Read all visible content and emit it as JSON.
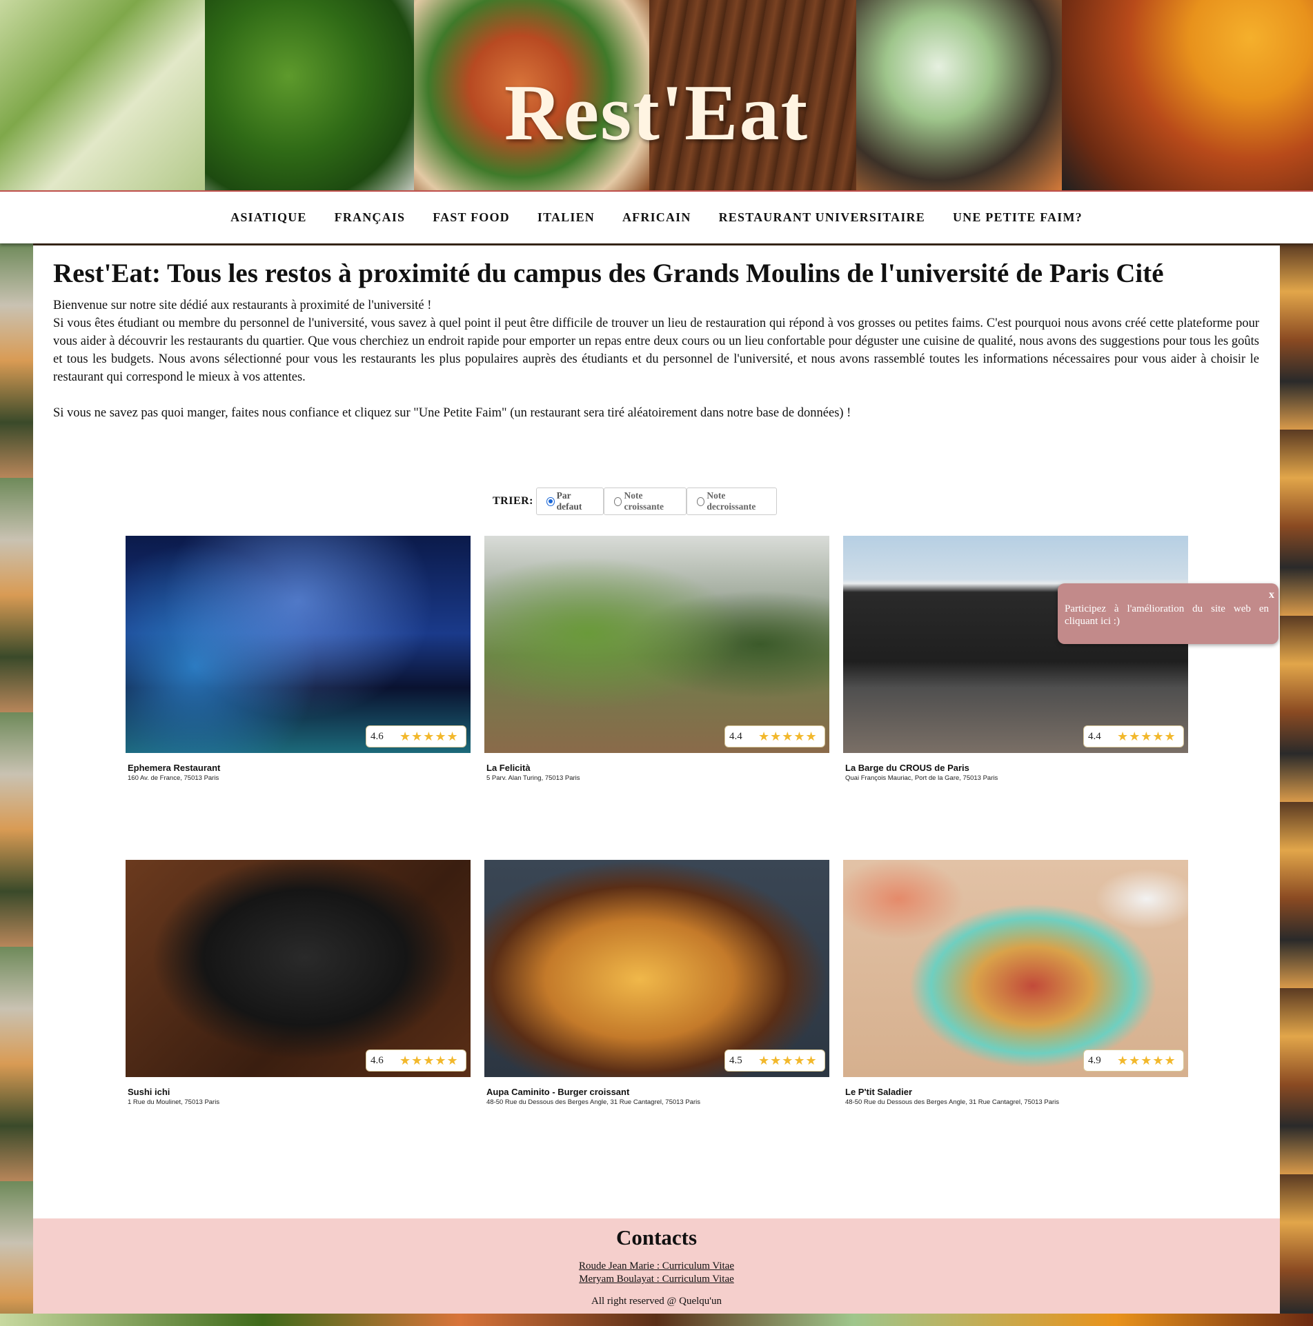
{
  "site": {
    "logo": "Rest'Eat"
  },
  "nav": {
    "items": [
      "ASIATIQUE",
      "FRANÇAIS",
      "FAST FOOD",
      "ITALIEN",
      "AFRICAIN",
      "RESTAURANT UNIVERSITAIRE",
      "UNE PETITE FAIM?"
    ]
  },
  "main": {
    "title": "Rest'Eat: Tous les restos à proximité du campus des Grands Moulins de l'université de Paris Cité",
    "intro": [
      "Bienvenue sur notre site dédié aux restaurants à proximité de l'université !",
      "Si vous êtes étudiant ou membre du personnel de l'université, vous savez à quel point il peut être difficile de trouver un lieu de restauration qui répond à vos grosses ou petites faims. C'est pourquoi nous avons créé cette plateforme pour vous aider à découvrir les restaurants du quartier. Que vous cherchiez un endroit rapide pour emporter un repas entre deux cours ou un lieu confortable pour déguster une cuisine de qualité, nous avons des suggestions pour tous les goûts et tous les budgets. Nous avons sélectionné pour vous les restaurants les plus populaires auprès des étudiants et du personnel de l'université, et nous avons rassemblé toutes les informations nécessaires pour vous aider à choisir le restaurant qui correspond le mieux à vos attentes.",
      "Si vous ne savez pas quoi manger, faites nous confiance et cliquez sur \"Une Petite Faim\" (un restaurant sera tiré aléatoirement dans notre base de données) !"
    ]
  },
  "sort": {
    "label": "TRIER:",
    "options": [
      "Par defaut",
      "Note croissante",
      "Note decroissante"
    ],
    "selected": "Par defaut"
  },
  "restaurants": [
    {
      "name": "Ephemera Restaurant",
      "address": "160 Av. de France, 75013 Paris",
      "rating": "4.6",
      "stars": "★★★★★"
    },
    {
      "name": "La Felicità",
      "address": "5 Parv. Alan Turing, 75013 Paris",
      "rating": "4.4",
      "stars": "★★★★★"
    },
    {
      "name": "La Barge du CROUS de Paris",
      "address": "Quai François Mauriac, Port de la Gare, 75013 Paris",
      "rating": "4.4",
      "stars": "★★★★★"
    },
    {
      "name": "Sushi ichi",
      "address": "1 Rue du Moulinet, 75013 Paris",
      "rating": "4.6",
      "stars": "★★★★★"
    },
    {
      "name": "Aupa Caminito - Burger croissant",
      "address": "48-50 Rue du Dessous des Berges Angle, 31 Rue Cantagrel, 75013 Paris",
      "rating": "4.5",
      "stars": "★★★★★"
    },
    {
      "name": "Le P'tit Saladier",
      "address": "48-50 Rue du Dessous des Berges Angle, 31 Rue Cantagrel, 75013 Paris",
      "rating": "4.9",
      "stars": "★★★★★"
    }
  ],
  "popup": {
    "close": "x",
    "text": "Participez à l'amélioration du site web en cliquant ici :)"
  },
  "footer": {
    "title": "Contacts",
    "links": [
      "Roude Jean Marie : Curriculum Vitae",
      "Meryam Boulayat : Curriculum Vitae"
    ],
    "copyright": "All right reserved @ Quelqu'un"
  },
  "colors": {
    "accent_border": "#c0504d",
    "popup_bg": "#c28a8a",
    "footer_bg": "#f5cfcc",
    "star": "#f2b82c",
    "radio_selected": "#1a66d6"
  }
}
